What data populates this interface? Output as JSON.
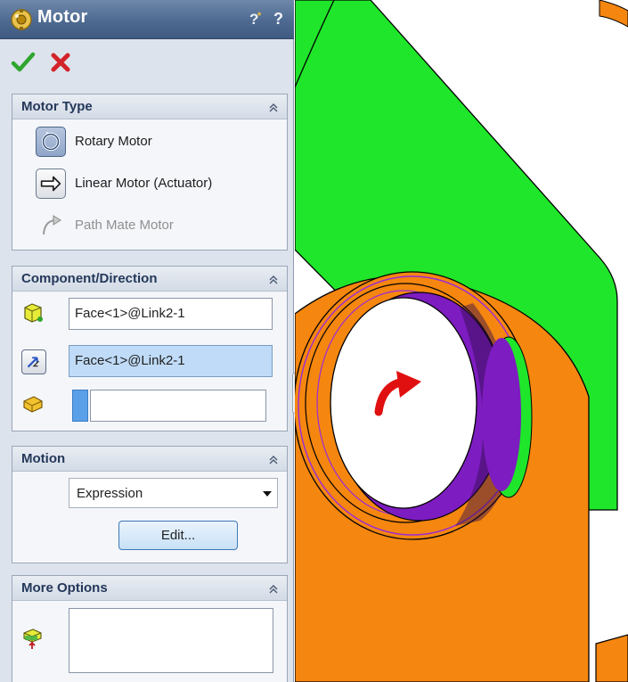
{
  "window": {
    "title": "Motor"
  },
  "colors": {
    "header": "#4e6a91",
    "accept": "#2fa52f",
    "cancel": "#d3232a",
    "highlight": "#bfdbf7"
  },
  "icons": {
    "title": "motor-icon",
    "help1": "whats-wrong-help-icon",
    "help2": "help-icon",
    "ok": "checkmark-icon",
    "cancel": "close-x-icon"
  },
  "motor_type": {
    "header": "Motor Type",
    "options": [
      {
        "label": "Rotary Motor",
        "icon": "rotary-motor-icon",
        "selected": true
      },
      {
        "label": "Linear Motor (Actuator)",
        "icon": "linear-motor-icon",
        "selected": false
      },
      {
        "label": "Path Mate Motor",
        "icon": "path-mate-motor-icon",
        "disabled": true
      }
    ]
  },
  "component_direction": {
    "header": "Component/Direction",
    "location_value": "Face<1>@Link2-1",
    "direction_value": "Face<1>@Link2-1",
    "load_value": ""
  },
  "motion": {
    "header": "Motion",
    "type_selected": "Expression",
    "edit_label": "Edit..."
  },
  "more_options": {
    "header": "More Options"
  }
}
